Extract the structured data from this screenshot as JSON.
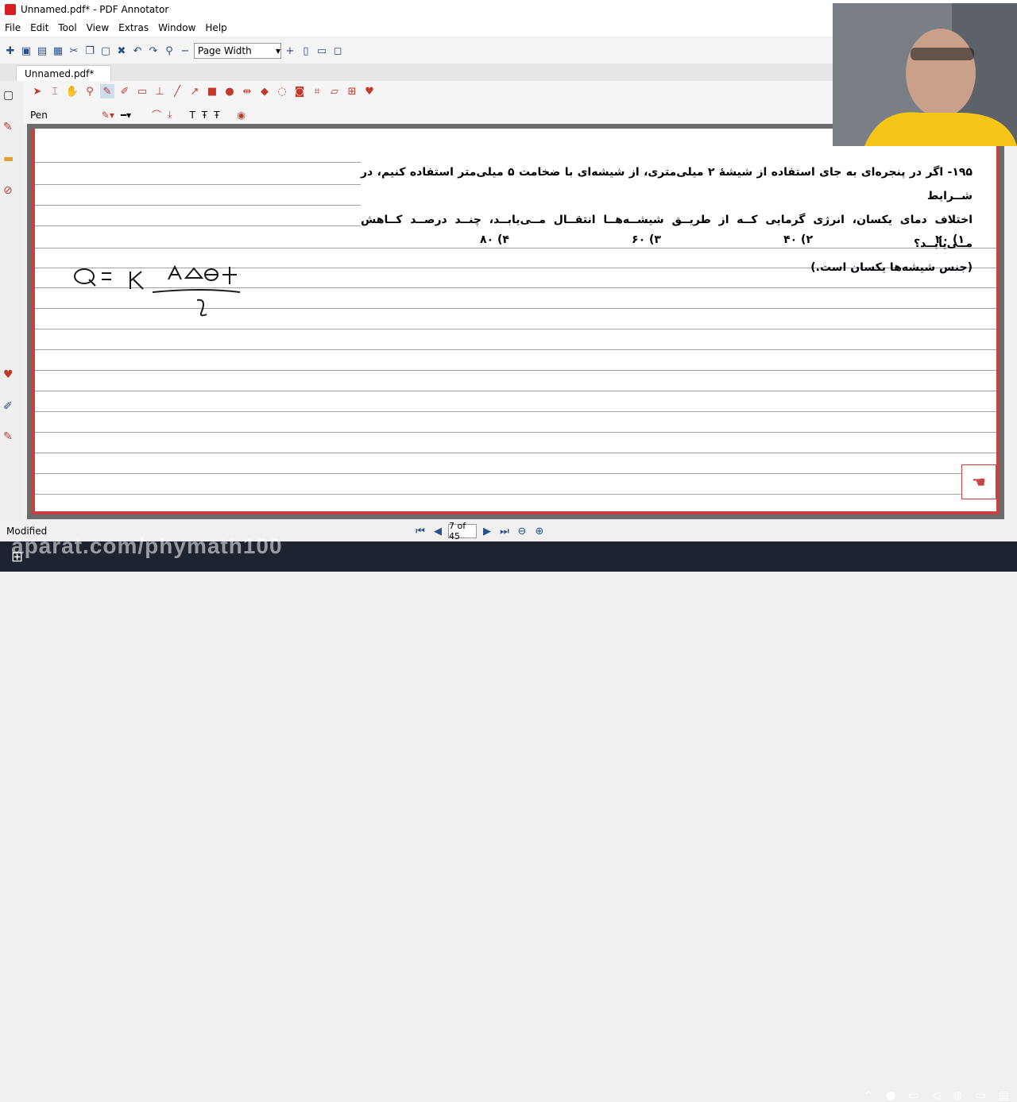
{
  "window": {
    "title": "Unnamed.pdf* - PDF Annotator"
  },
  "menu": [
    "File",
    "Edit",
    "Tool",
    "View",
    "Extras",
    "Window",
    "Help"
  ],
  "toolbar": {
    "zoom_label": "Page Width"
  },
  "tab": {
    "label": "Unnamed.pdf*"
  },
  "tools": {
    "current_tool": "Pen"
  },
  "document": {
    "question_line1": "۱۹۵- اگر در پنجره‌ای به جای استفاده از شیشهٔ ۲ میلی‌متری، از شیشه‌ای با ضخامت ۵ میلی‌متر استفاده کنیم، در شــرایط",
    "question_line2": "اختلاف دمای یکسان، انرژی گرمایی کــه از طریــق شیشــه‌هــا انتقــال مــی‌یابــد، چنــد درصــد کــاهش مــی‌یابــد؟",
    "question_line3": "(جنس شیشه‌ها یکسان است.)",
    "options": [
      "۱) ۲۰",
      "۲) ۴۰",
      "۳) ۶۰",
      "۴) ۸۰"
    ],
    "handwritten": "Q = K AΔθt / l"
  },
  "status": {
    "left": "Modified",
    "page_indicator": "7 of 45"
  },
  "watermark": "aparat.com/phymath100"
}
